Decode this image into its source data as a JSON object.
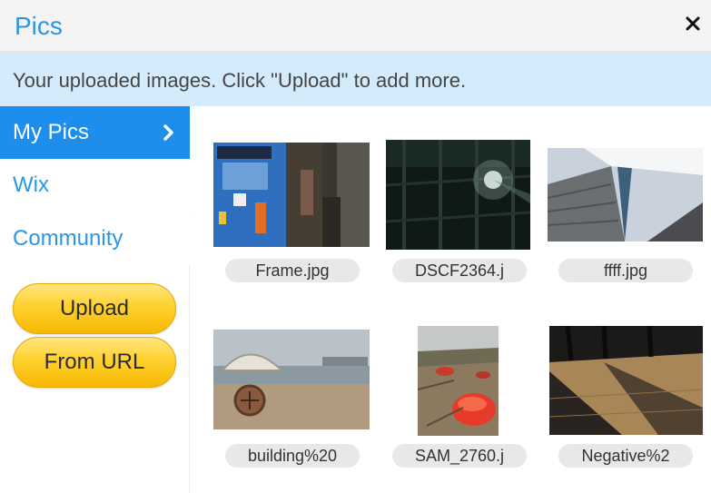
{
  "header": {
    "title": "Pics",
    "close_icon": "close-icon"
  },
  "info": {
    "message": "Your uploaded images. Click \"Upload\"  to add more."
  },
  "sidebar": {
    "items": [
      {
        "label": "My Pics",
        "active": true
      },
      {
        "label": "Wix"
      },
      {
        "label": "Community"
      }
    ],
    "upload_label": "Upload",
    "from_url_label": "From URL"
  },
  "images": [
    {
      "caption": "Frame.jpg"
    },
    {
      "caption": "DSCF2364.j"
    },
    {
      "caption": "ffff.jpg"
    },
    {
      "caption": "building%20"
    },
    {
      "caption": "SAM_2760.j"
    },
    {
      "caption": "Negative%2"
    }
  ],
  "colors": {
    "accent": "#2a97e6",
    "active": "#1e8eec",
    "info_bg": "#d3ebfb",
    "button": "#ffd12e"
  }
}
